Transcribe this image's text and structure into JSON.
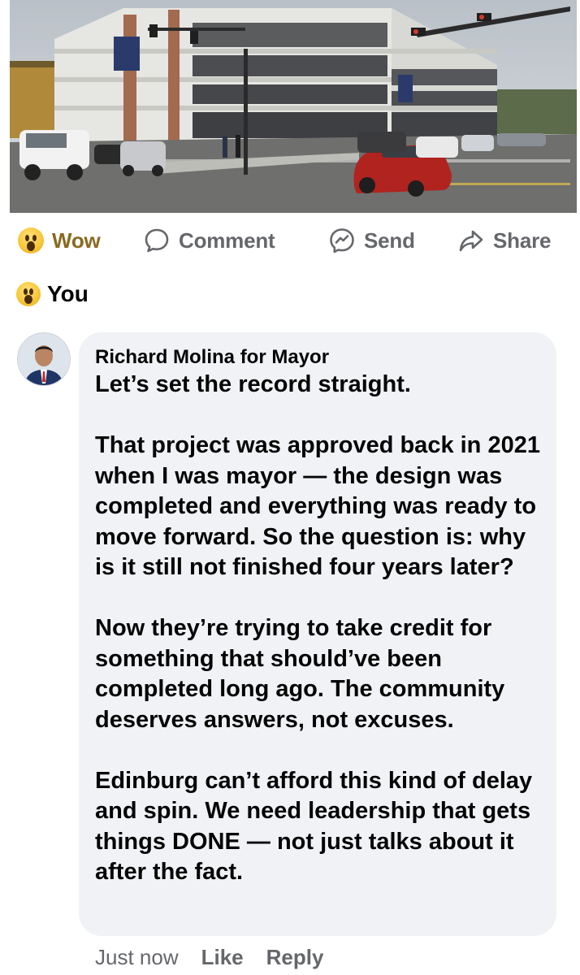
{
  "post": {
    "photo_description_icon": "photo-parking-garage"
  },
  "actions": {
    "wow_label": "Wow",
    "comment_label": "Comment",
    "send_label": "Send",
    "share_label": "Share"
  },
  "reaction": {
    "user_label": "You",
    "icon": "wow-emoji-icon"
  },
  "comment": {
    "author": "Richard Molina for Mayor",
    "paragraphs": [
      "Let’s set the record straight.",
      "That project was approved back in 2021 when I was mayor — the design was completed and everything was ready to move forward. So the question is: why is it still not finished four years later?",
      "Now they’re trying to take credit for something that should’ve been completed long ago. The community deserves answers, not excuses.",
      "Edinburg can’t afford this kind of delay and spin. We need leadership that gets things DONE — not just talks about it after the fact."
    ],
    "timestamp": "Just now",
    "like_label": "Like",
    "reply_label": "Reply"
  },
  "colors": {
    "bubble": "#f0f2f5",
    "secondary_text": "#65676b",
    "wow_text": "#8a6a1f"
  }
}
